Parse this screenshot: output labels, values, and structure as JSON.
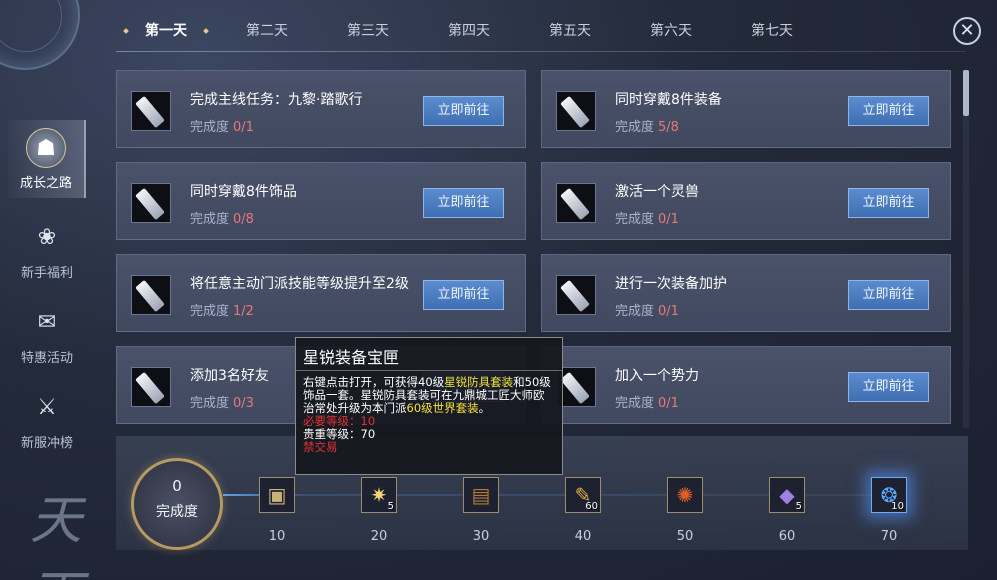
{
  "tabs": [
    "第一天",
    "第二天",
    "第三天",
    "第四天",
    "第五天",
    "第六天",
    "第七天"
  ],
  "close_icon": "close-icon",
  "sidebar": {
    "items": [
      {
        "label": "成长之路",
        "icon": "growth-icon",
        "active": true
      },
      {
        "label": "新手福利",
        "icon": "gift-bag-icon",
        "active": false
      },
      {
        "label": "特惠活动",
        "icon": "gift-box-icon",
        "active": false
      },
      {
        "label": "新服冲榜",
        "icon": "ranking-icon",
        "active": false
      }
    ]
  },
  "progress_label": "完成度",
  "go_label": "立即前往",
  "tasks": [
    {
      "name": "完成主线任务：九黎·踏歌行",
      "progress": "0/1"
    },
    {
      "name": "同时穿戴8件装备",
      "progress": "5/8"
    },
    {
      "name": "同时穿戴8件饰品",
      "progress": "0/8"
    },
    {
      "name": "激活一个灵兽",
      "progress": "0/1"
    },
    {
      "name": "将任意主动门派技能等级提升至2级",
      "progress": "1/2"
    },
    {
      "name": "进行一次装备加护",
      "progress": "0/1"
    },
    {
      "name": "添加3名好友",
      "progress": "0/3"
    },
    {
      "name": "加入一个势力",
      "progress": "0/1"
    }
  ],
  "completion": {
    "value": "0",
    "label": "完成度"
  },
  "rewards": [
    {
      "level": "10",
      "qty": "",
      "icon": "treasure-chest-icon"
    },
    {
      "level": "20",
      "qty": "5",
      "icon": "sparkle-orb-icon"
    },
    {
      "level": "30",
      "qty": "",
      "icon": "wooden-chest-icon"
    },
    {
      "level": "40",
      "qty": "60",
      "icon": "scroll-icon"
    },
    {
      "level": "50",
      "qty": "",
      "icon": "fire-rune-icon"
    },
    {
      "level": "60",
      "qty": "5",
      "icon": "crystal-card-icon"
    },
    {
      "level": "70",
      "qty": "10",
      "icon": "blue-gem-icon"
    }
  ],
  "tooltip": {
    "title": "星锐装备宝匣",
    "desc_1": "右键点击打开，可获得40级",
    "desc_2": "星锐防具套装",
    "desc_3": "和50级饰品一套。星锐防具套装可在九鼎城工匠大师欧治常处升级为本门派",
    "desc_4": "60级世界套装",
    "desc_5": "。",
    "req_level": "必要等级：10",
    "value_level": "贵重等级：70",
    "no_trade": "禁交易"
  },
  "logo_text": "天下",
  "colors": {
    "accent_blue": "#4a7cc0",
    "progress_red": "#e87878",
    "highlight_yellow": "#f5e23a",
    "warning_red": "#e03232"
  }
}
